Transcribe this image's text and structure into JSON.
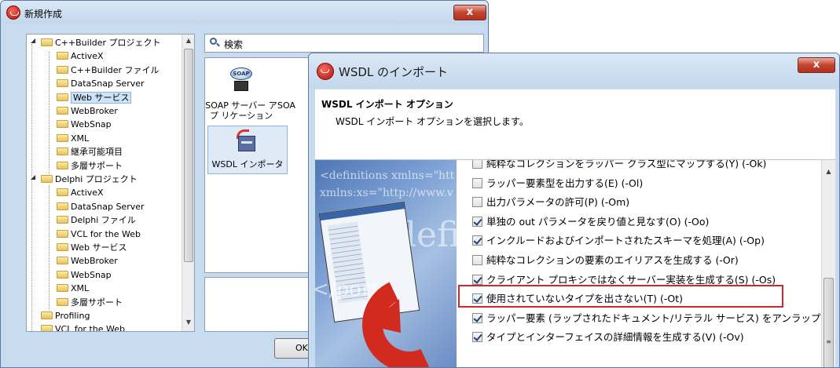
{
  "new_dialog": {
    "title": "新規作成",
    "close_label": "x",
    "tree": [
      {
        "label": "C++Builder プロジェクト",
        "expanded": true
      },
      {
        "label": "ActiveX"
      },
      {
        "label": "C++Builder ファイル"
      },
      {
        "label": "DataSnap Server"
      },
      {
        "label": "Web サービス",
        "selected": true
      },
      {
        "label": "WebBroker"
      },
      {
        "label": "WebSnap"
      },
      {
        "label": "XML"
      },
      {
        "label": "継承可能項目"
      },
      {
        "label": "多層サポート"
      },
      {
        "label": "Delphi プロジェクト",
        "expanded": true
      },
      {
        "label": "ActiveX"
      },
      {
        "label": "DataSnap Server"
      },
      {
        "label": "Delphi ファイル"
      },
      {
        "label": "VCL for the Web"
      },
      {
        "label": "Web サービス"
      },
      {
        "label": "WebBroker"
      },
      {
        "label": "WebSnap"
      },
      {
        "label": "XML"
      },
      {
        "label": "多層サポート"
      },
      {
        "label": "Profiling"
      },
      {
        "label": "VCL for the Web"
      }
    ],
    "search_placeholder": "検索",
    "items": [
      {
        "label": "SOAP サーバー アプ リケーション",
        "icon": "soap-icon",
        "icon_text": "SOAP"
      },
      {
        "label": "SOA",
        "icon": "none"
      },
      {
        "label": "WSDL インポータ",
        "icon": "wsdl-importer-icon",
        "selected": true
      }
    ],
    "ok_label": "OK"
  },
  "wsdl_dialog": {
    "title": "WSDL のインポート",
    "close_label": "x",
    "header_title": "WSDL インポート オプション",
    "header_subtitle": "WSDL インポート オプションを選択します。",
    "art_text": {
      "line1": "<definitions xmlns=\"htt",
      "line2": "xmlns:xs=\"http://www.v",
      "line3": "<defini",
      "line4": "</port>"
    },
    "options": [
      {
        "label": "純粋なコレクションをラッパー クラス型にマップする(Y) (-Ok)",
        "checked": false
      },
      {
        "label": "ラッパー要素型を出力する(E) (-Ol)",
        "checked": false
      },
      {
        "label": "出力パラメータの許可(P) (-Om)",
        "checked": false
      },
      {
        "label": "単独の out パラメータを戻り値と見なす(O) (-Oo)",
        "checked": true
      },
      {
        "label": "インクルードおよびインポートされたスキーマを処理(A) (-Op)",
        "checked": true
      },
      {
        "label": "純粋なコレクションの要素のエイリアスを生成する (-Or)",
        "checked": false
      },
      {
        "label": "クライアント プロキシではなくサーバー実装を生成する(S) (-Os)",
        "checked": true,
        "highlighted": true
      },
      {
        "label": "使用されていないタイプを出さない(T) (-Ot)",
        "checked": true
      },
      {
        "label": "ラッパー要素 (ラップされたドキュメント/リテラル サービス) をアンラップする",
        "checked": true
      },
      {
        "label": "タイプとインターフェイスの詳細情報を生成する(V) (-Ov)",
        "checked": true
      }
    ]
  },
  "colors": {
    "highlight": "#d0262d",
    "window_frame": "#c9dbee",
    "selection": "#cde3f7"
  }
}
